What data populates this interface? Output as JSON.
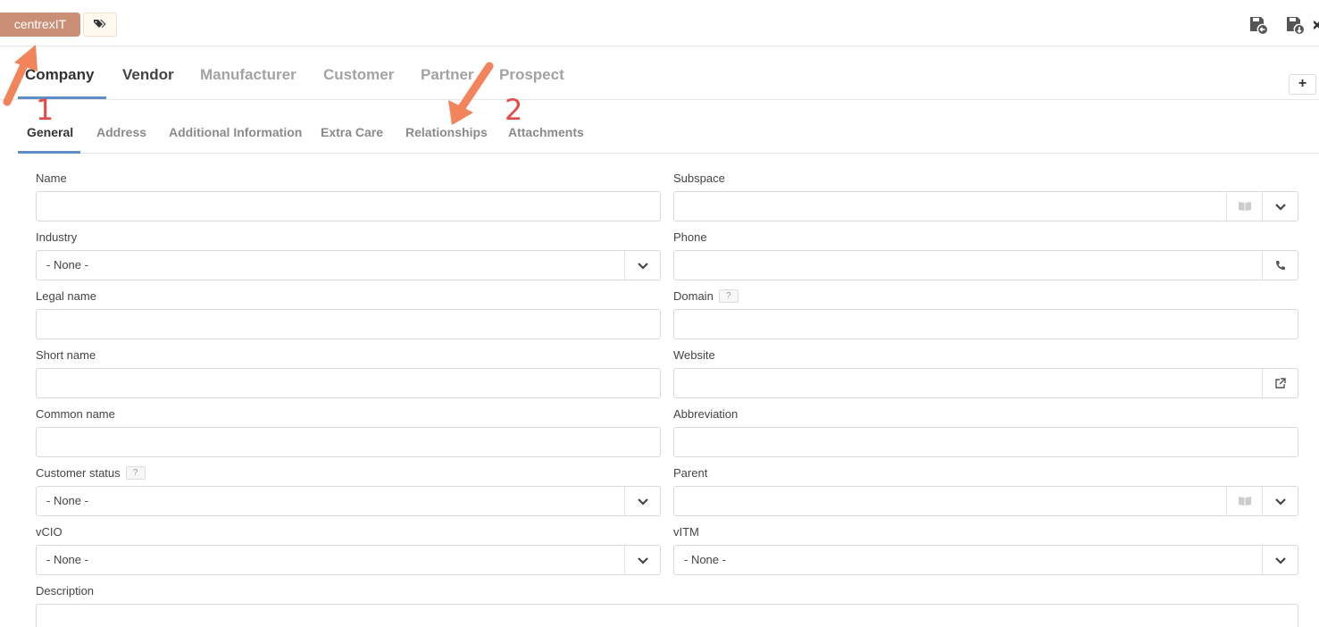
{
  "header": {
    "space_name": "centrexIT",
    "icons": [
      "tag-icon",
      "save-back-icon",
      "save-download-icon",
      "close-icon"
    ],
    "accent_color": "#c99077"
  },
  "type_tabs": {
    "items": [
      "Company",
      "Vendor",
      "Manufacturer",
      "Customer",
      "Partner",
      "Prospect"
    ],
    "active": "Company",
    "add_label": "+"
  },
  "sub_tabs": {
    "items": [
      "General",
      "Address",
      "Additional Information",
      "Extra Care",
      "Relationships",
      "Attachments"
    ],
    "active": "General"
  },
  "form": {
    "name": {
      "label": "Name",
      "value": ""
    },
    "subspace": {
      "label": "Subspace",
      "value": ""
    },
    "industry": {
      "label": "Industry",
      "value": "- None -"
    },
    "phone": {
      "label": "Phone",
      "value": ""
    },
    "legal_name": {
      "label": "Legal name",
      "value": ""
    },
    "domain": {
      "label": "Domain",
      "help": "?",
      "value": ""
    },
    "short_name": {
      "label": "Short name",
      "value": ""
    },
    "website": {
      "label": "Website",
      "value": ""
    },
    "common_name": {
      "label": "Common name",
      "value": ""
    },
    "abbreviation": {
      "label": "Abbreviation",
      "value": ""
    },
    "customer_status": {
      "label": "Customer status",
      "help": "?",
      "value": "- None -"
    },
    "parent": {
      "label": "Parent",
      "value": ""
    },
    "vcio": {
      "label": "vCIO",
      "value": "- None -"
    },
    "vitm": {
      "label": "vITM",
      "value": "- None -"
    },
    "description": {
      "label": "Description",
      "value": ""
    }
  },
  "annotations": {
    "marker_1": "1",
    "marker_2": "2",
    "arrow_color": "#f2845c"
  }
}
